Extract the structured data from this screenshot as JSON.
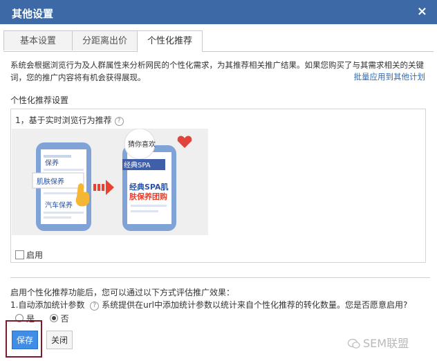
{
  "dialog": {
    "title": "其他设置",
    "close_symbol": "×"
  },
  "tabs": [
    {
      "label": "基本设置",
      "active": false
    },
    {
      "label": "分距离出价",
      "active": false
    },
    {
      "label": "个性化推荐",
      "active": true
    }
  ],
  "description": "系统会根据浏览行为及人群属性来分析网民的个性化需求，为其推荐相关推广结果。如果您购买了与其需求相关的关键词，您的推广内容将有机会获得展现。",
  "batch_link": "批量应用到其他计划",
  "section_title": "个性化推荐设置",
  "panel": {
    "heading": "1，基于实时浏览行为推荐",
    "help_glyph": "?",
    "illustration": {
      "left_items": [
        "保养",
        "肌肤保养",
        "汽车保养"
      ],
      "right_heading": "猜你喜欢",
      "right_item": "经典SPA",
      "right_result": [
        "经典SPA肌",
        "肤保养团购"
      ]
    },
    "enable_label": "启用",
    "enable_checked": false
  },
  "evaluation": {
    "title": "启用个性化推荐功能后，您可以通过以下方式评估推广效果：",
    "item_prefix": "1.自动添加统计参数",
    "help_glyph": "?",
    "item_text": "系统提供在url中添加统计参数以统计来自个性化推荐的转化数量。您是否愿意启用?",
    "options": [
      {
        "label": "是",
        "checked": false
      },
      {
        "label": "否",
        "checked": true
      }
    ]
  },
  "buttons": {
    "save": "保存",
    "close": "关闭"
  },
  "watermark": "SEM联盟",
  "colors": {
    "title_bar": "#3d6aa6",
    "link": "#2a6bbd",
    "save_button": "#3f8de6",
    "highlight_frame": "#7a1a2a",
    "heart": "#e0443a",
    "arrow": "#e8412f"
  }
}
